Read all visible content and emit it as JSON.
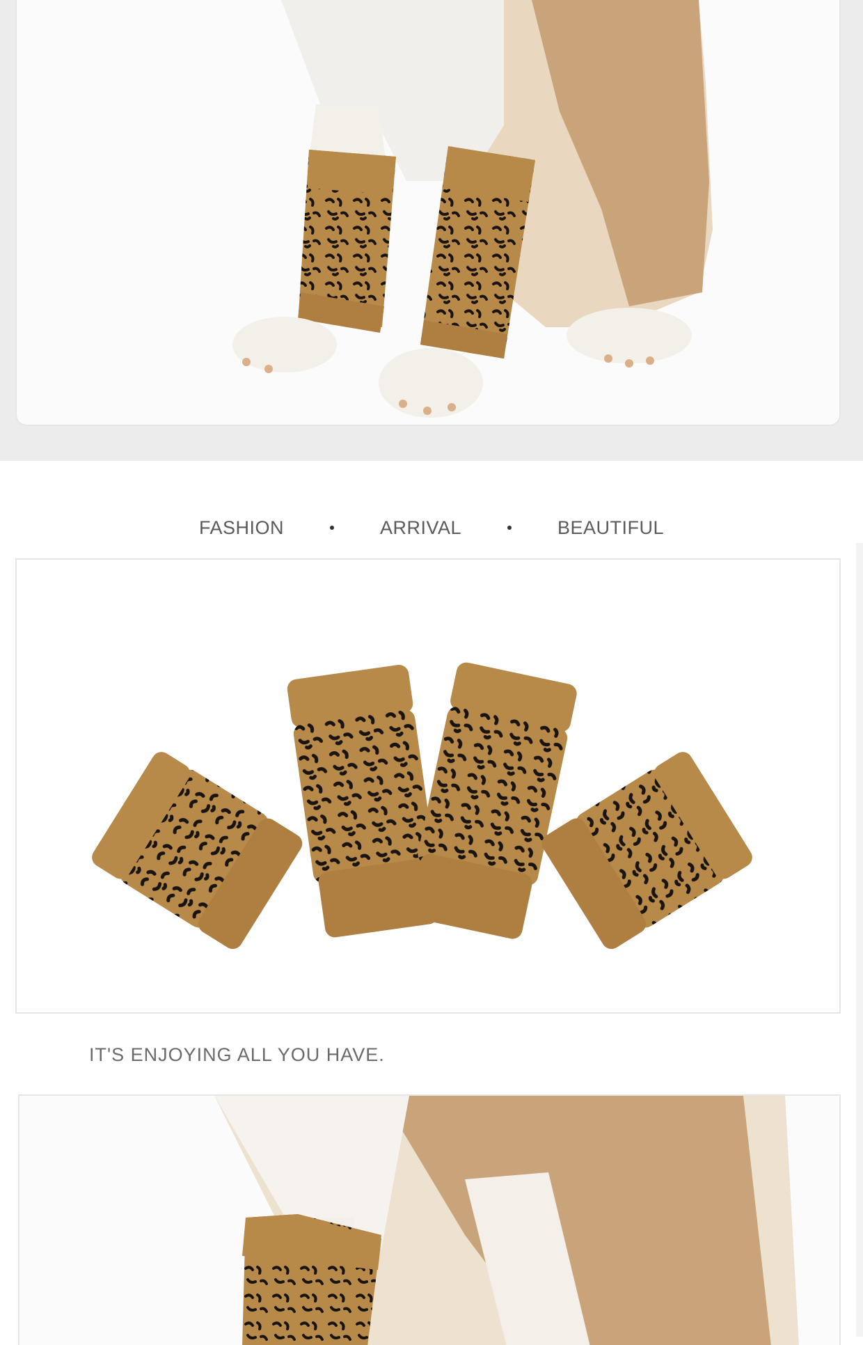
{
  "tagline": {
    "word1": "FASHION",
    "word2": "ARRIVAL",
    "word3": "BEAUTIFUL"
  },
  "subline": {
    "text": "IT'S ENJOYING ALL YOU HAVE."
  },
  "images": {
    "top": "dog-wearing-leopard-leg-warmers-photo",
    "middle": "four-leopard-print-leg-warmers-photo",
    "bottom": "dog-wearing-leopard-leg-warmer-closeup-photo"
  },
  "colors": {
    "knit": "#b88a4a",
    "spots": "#1a1410",
    "fur_tan": "#c9a37a",
    "fur_white": "#f1efeb"
  }
}
